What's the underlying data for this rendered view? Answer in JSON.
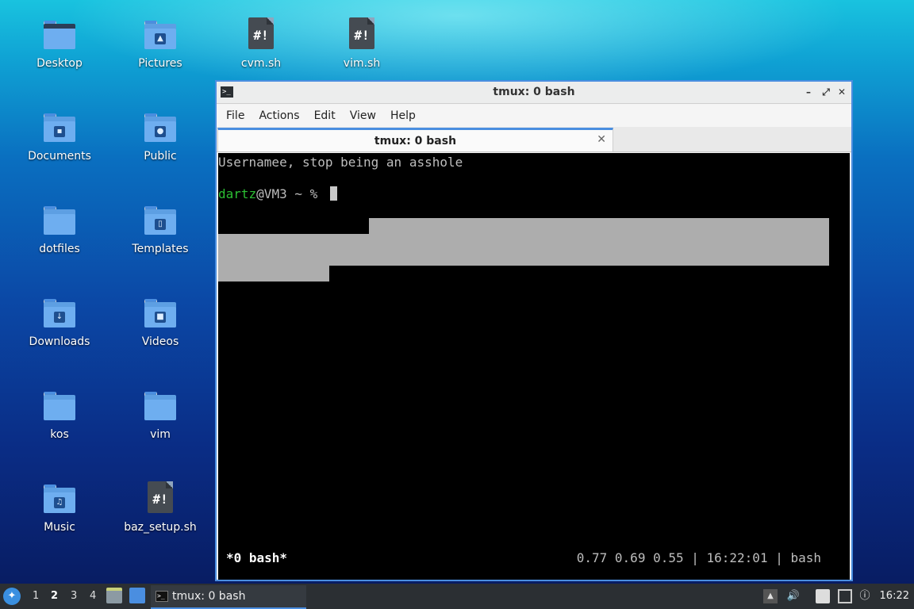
{
  "desktop": {
    "icons": [
      {
        "label": "Desktop",
        "glyph": "desktop-folder-icon"
      },
      {
        "label": "Pictures",
        "glyph": "pictures-folder-icon"
      },
      {
        "label": "cvm.sh",
        "glyph": "shell-script-icon"
      },
      {
        "label": "vim.sh",
        "glyph": "shell-script-icon"
      },
      {
        "label": "Documents",
        "glyph": "documents-folder-icon"
      },
      {
        "label": "Public",
        "glyph": "public-folder-icon"
      },
      {
        "label": "dotfiles",
        "glyph": "folder-icon"
      },
      {
        "label": "Templates",
        "glyph": "templates-folder-icon"
      },
      {
        "label": "Downloads",
        "glyph": "downloads-folder-icon"
      },
      {
        "label": "Videos",
        "glyph": "videos-folder-icon"
      },
      {
        "label": "kos",
        "glyph": "folder-icon"
      },
      {
        "label": "vim",
        "glyph": "folder-icon"
      },
      {
        "label": "Music",
        "glyph": "music-folder-icon"
      },
      {
        "label": "baz_setup.sh",
        "glyph": "shell-script-icon"
      }
    ],
    "script_glyph": "#!"
  },
  "window": {
    "title": "tmux: 0 bash",
    "minimize": "–",
    "maximize": "⤢",
    "close": "✕",
    "menu": [
      "File",
      "Actions",
      "Edit",
      "View",
      "Help"
    ],
    "tab_label": "tmux: 0 bash",
    "tab_close": "✕"
  },
  "terminal": {
    "line1": "Usernamee, stop being an asshole",
    "prompt_user": "dartz",
    "prompt_rest": "@VM3 ~ % ",
    "status_left": "*0 bash*",
    "status_right": "0.77 0.69 0.55 | 16:22:01 | bash"
  },
  "taskbar": {
    "workspaces": [
      "1",
      "2",
      "3",
      "4"
    ],
    "active_workspace": "2",
    "task_label": "tmux: 0 bash",
    "clock": "16:22"
  },
  "colors": {
    "accent": "#4a8ee0",
    "prompt_green": "#2cbf33",
    "terminal_bg": "#000000"
  }
}
